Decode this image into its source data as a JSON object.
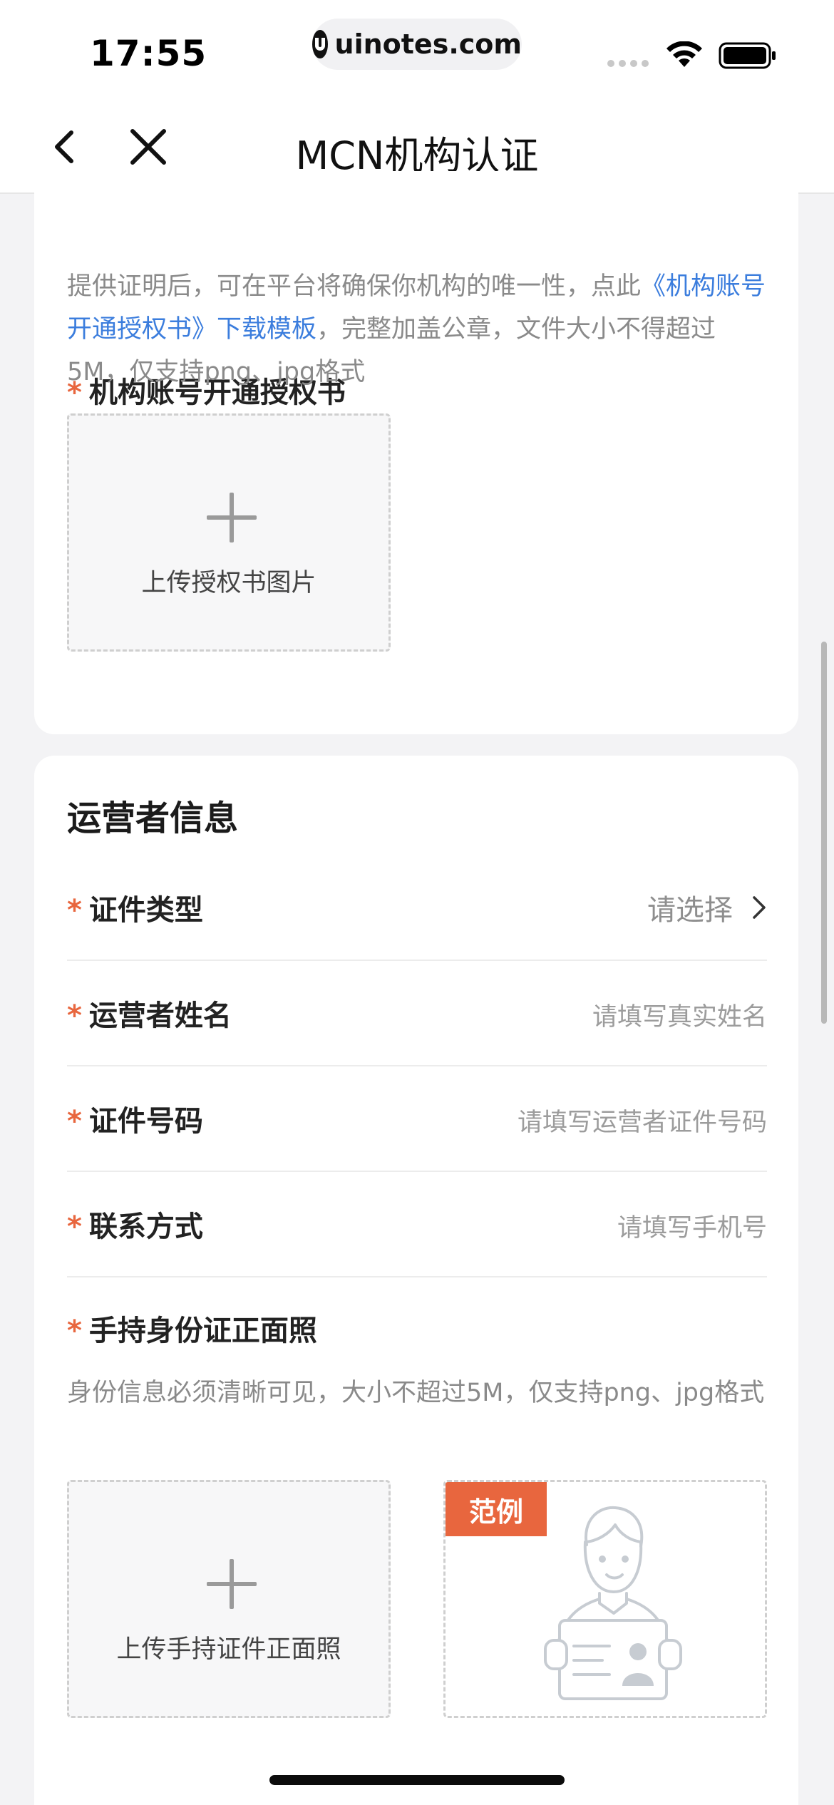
{
  "status_bar": {
    "time": "17:55",
    "url": "uinotes.com"
  },
  "nav": {
    "title": "MCN机构认证"
  },
  "authorization": {
    "required_mark": "*",
    "label": "机构账号开通授权书",
    "desc_prefix": "提供证明后，可在平台将确保你机构的唯一性，点此",
    "desc_link": "《机构账号开通授权书》下载模板",
    "desc_suffix": "，完整加盖公章，文件大小不得超过5M，仅支持png、jpg格式",
    "upload_label": "上传授权书图片"
  },
  "operator": {
    "section_title": "运营者信息",
    "fields": [
      {
        "label": "证件类型",
        "value": "请选择",
        "type": "select"
      },
      {
        "label": "运营者姓名",
        "placeholder": "请填写真实姓名",
        "type": "input"
      },
      {
        "label": "证件号码",
        "placeholder": "请填写运营者证件号码",
        "type": "input"
      },
      {
        "label": "联系方式",
        "placeholder": "请填写手机号",
        "type": "input"
      }
    ],
    "id_photo": {
      "label": "手持身份证正面照",
      "desc": "身份信息必须清晰可见，大小不超过5M，仅支持png、jpg格式",
      "upload_label": "上传手持证件正面照",
      "example_badge": "范例"
    }
  },
  "colors": {
    "accent_red": "#e8663e",
    "link_blue": "#3b7ddd"
  }
}
